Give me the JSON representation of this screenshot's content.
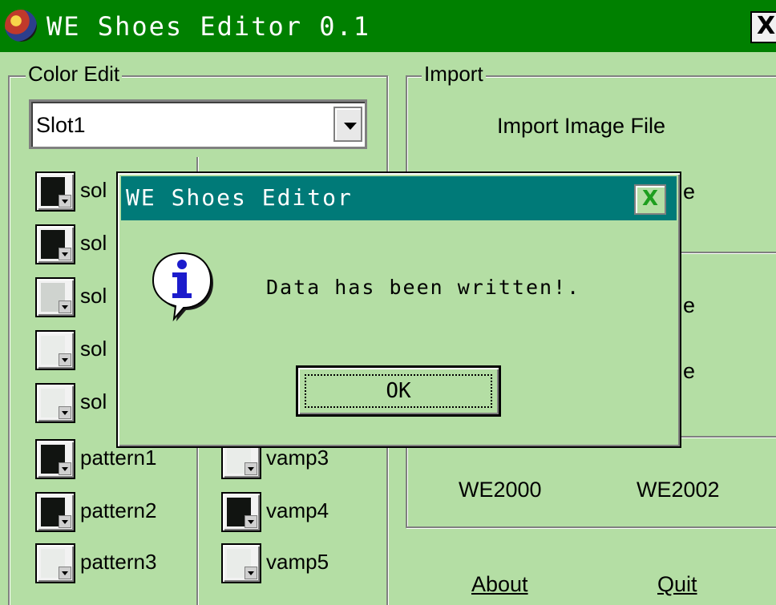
{
  "window": {
    "title": "WE Shoes Editor 0.1",
    "close_glyph": "X",
    "icon": "app-ball-icon"
  },
  "color_edit": {
    "label": "Color Edit",
    "slot_select": {
      "value": "Slot1"
    },
    "left_column": [
      {
        "label": "sol",
        "color": "#111411"
      },
      {
        "label": "sol",
        "color": "#111411"
      },
      {
        "label": "sol",
        "color": "#cfd3cf"
      },
      {
        "label": "sol",
        "color": "#e9ece9"
      },
      {
        "label": "sol",
        "color": "#e9ece9"
      },
      {
        "label": "pattern1",
        "color": "#111411"
      },
      {
        "label": "pattern2",
        "color": "#111411"
      },
      {
        "label": "pattern3",
        "color": "#e9ece9"
      }
    ],
    "right_column": [
      {
        "label": "vamp3",
        "color": "#e9ece9"
      },
      {
        "label": "vamp4",
        "color": "#111411"
      },
      {
        "label": "vamp5",
        "color": "#e9ece9"
      }
    ]
  },
  "import": {
    "label": "Import",
    "import_image_file": "Import Image File",
    "hidden_button_fragments": [
      "e",
      "e",
      "e"
    ]
  },
  "versions": {
    "we2000": "WE2000",
    "we2002": "WE2002"
  },
  "bottom_buttons": {
    "about": "About",
    "quit": "Quit"
  },
  "dialog": {
    "title": "WE Shoes Editor",
    "close_glyph": "X",
    "message": "Data has been written!.",
    "ok_label": "OK",
    "icon": "info-icon"
  },
  "colors": {
    "window_bg": "#b4dea4",
    "titlebar": "#008000",
    "dialog_titlebar": "#007a78"
  }
}
